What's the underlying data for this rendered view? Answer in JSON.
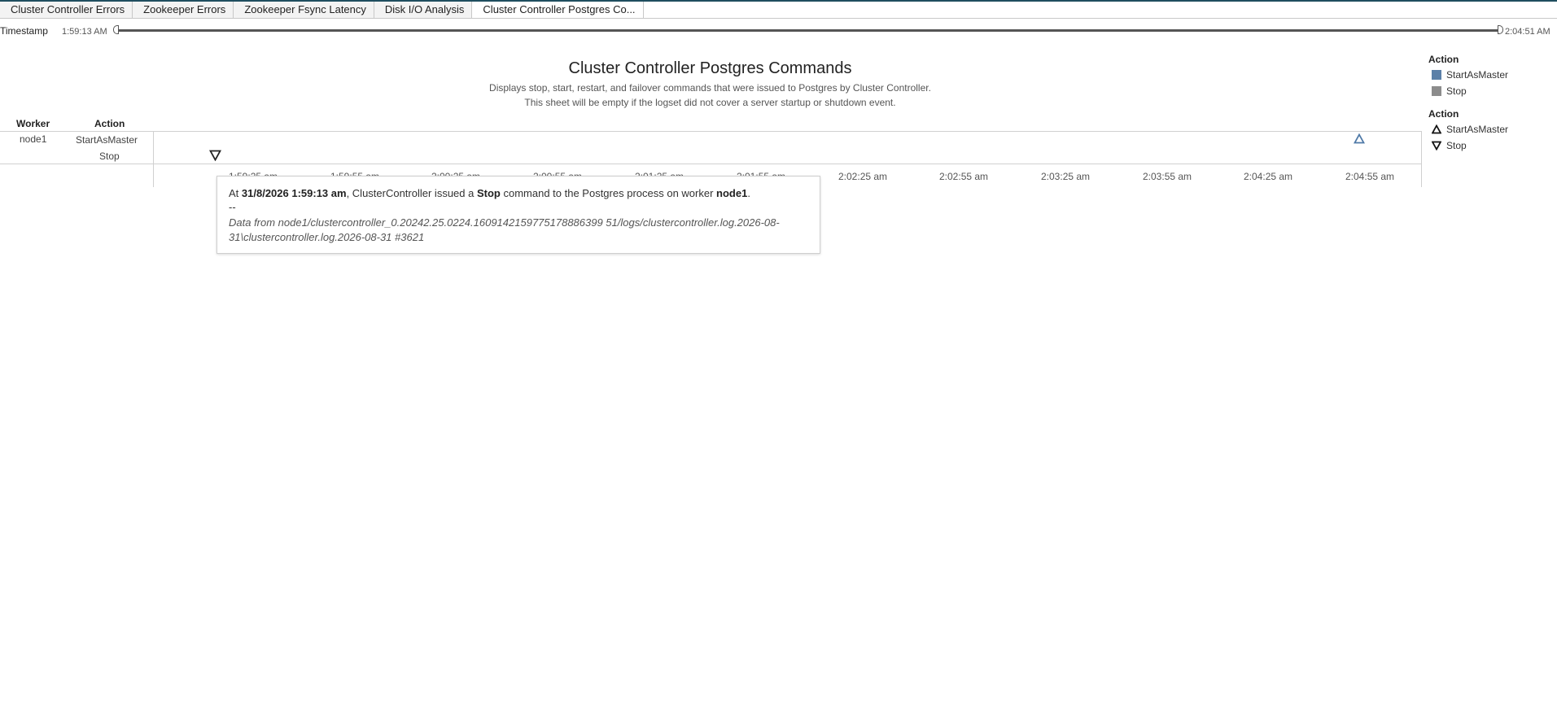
{
  "tabs": [
    {
      "label": "Cluster Controller Errors",
      "active": false
    },
    {
      "label": "Zookeeper Errors",
      "active": false
    },
    {
      "label": "Zookeeper Fsync Latency",
      "active": false
    },
    {
      "label": "Disk I/O Analysis",
      "active": false
    },
    {
      "label": "Cluster Controller Postgres Co...",
      "active": true
    }
  ],
  "filter": {
    "label": "Timestamp",
    "min": "1:59:13 AM",
    "max": "2:04:51 AM"
  },
  "sheet": {
    "title": "Cluster Controller Postgres Commands",
    "subtitle_1": "Displays stop, start, restart, and failover commands that were issued to Postgres by Cluster Controller.",
    "subtitle_2": "This sheet will be empty if the logset did not cover a server startup or shutdown event."
  },
  "table": {
    "worker_header": "Worker",
    "action_header": "Action",
    "worker": "node1",
    "actions": [
      "StartAsMaster",
      "Stop"
    ]
  },
  "chart_data": {
    "type": "scatter",
    "x_ticks": [
      "1:59:25 am",
      "1:59:55 am",
      "2:00:25 am",
      "2:00:55 am",
      "2:01:25 am",
      "2:01:55 am",
      "2:02:25 am",
      "2:02:55 am",
      "2:03:25 am",
      "2:03:55 am",
      "2:04:25 am",
      "2:04:55 am"
    ],
    "points": [
      {
        "action": "Stop",
        "worker": "node1",
        "time": "1:59:13 am",
        "marker": "triangle-down",
        "color": "#222222"
      },
      {
        "action": "StartAsMaster",
        "worker": "node1",
        "time": "2:04:51 am",
        "marker": "triangle-up",
        "color": "#4e79a7"
      }
    ]
  },
  "legend": {
    "color_title": "Action",
    "color_items": [
      {
        "label": "StartAsMaster",
        "color": "#5b80a8"
      },
      {
        "label": "Stop",
        "color": "#8c8c8c"
      }
    ],
    "shape_title": "Action",
    "shape_items": [
      {
        "label": "StartAsMaster",
        "icon": "triangle-up-icon"
      },
      {
        "label": "Stop",
        "icon": "triangle-down-icon"
      }
    ]
  },
  "tooltip": {
    "p1": "At ",
    "date": "31/8/2026 1:59:13 am",
    "p2": ", ClusterController issued a ",
    "command": "Stop",
    "p3": " command to the Postgres process on worker ",
    "worker": "node1",
    "p4": ".",
    "separator": "--",
    "source": "Data from node1/clustercontroller_0.20242.25.0224.1609142159775178886399 51/logs/clustercontroller.log.2026-08-31\\clustercontroller.log.2026-08-31 #3621"
  }
}
